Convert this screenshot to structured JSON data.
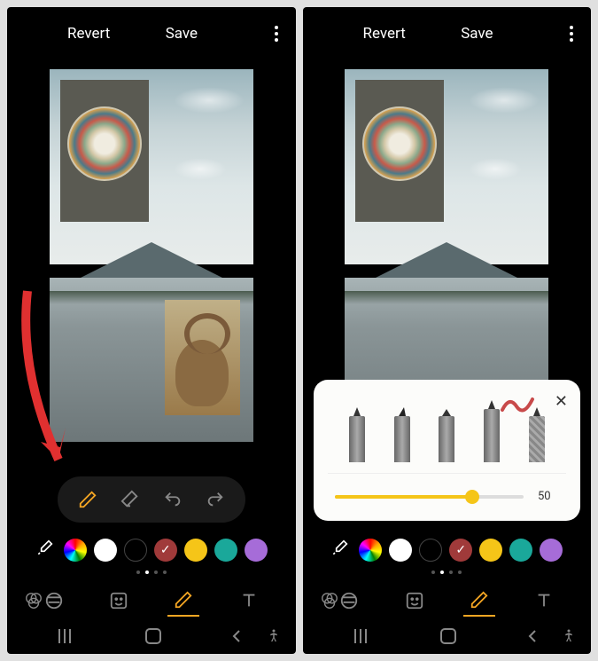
{
  "header": {
    "revert": "Revert",
    "save": "Save"
  },
  "toolbar": {
    "pen": "pen-icon",
    "eraser": "eraser-icon",
    "undo": "undo-icon",
    "redo": "redo-icon"
  },
  "colors": {
    "items": [
      {
        "type": "rainbow"
      },
      {
        "hex": "#ffffff"
      },
      {
        "hex": "#000000"
      },
      {
        "hex": "#a03a3a",
        "selected": true
      },
      {
        "hex": "#f5c518"
      },
      {
        "hex": "#1aa89a"
      },
      {
        "hex": "#a66cd8"
      }
    ]
  },
  "tabs": {
    "items": [
      "filters",
      "stickers",
      "draw",
      "text"
    ],
    "active": "draw",
    "side_icon": "rgb-circles-icon"
  },
  "popup": {
    "pens": [
      "pencil",
      "fountain",
      "marker",
      "brush",
      "pixel"
    ],
    "slider_value": "50"
  },
  "nav": {
    "recents": "recents-icon",
    "home": "home-icon",
    "back": "back-icon",
    "accessibility": "accessibility-icon"
  }
}
